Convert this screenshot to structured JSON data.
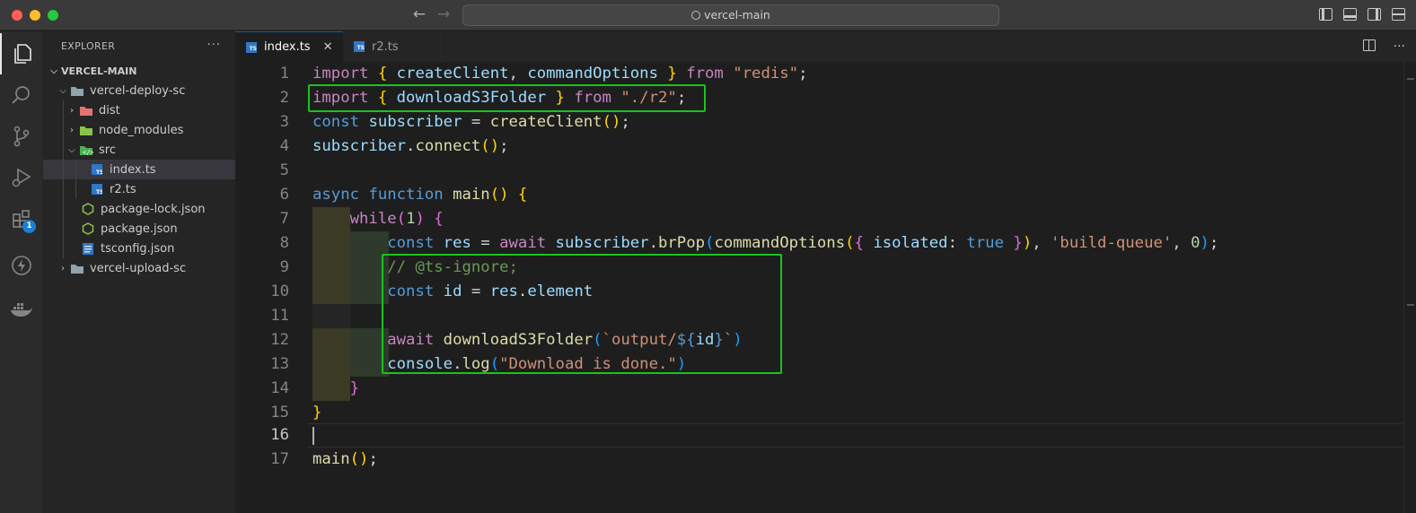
{
  "window": {
    "search_text": "vercel-main"
  },
  "activity_bar": {
    "extensions_badge": "1"
  },
  "explorer": {
    "title": "EXPLORER",
    "more": "···",
    "root": "VERCEL-MAIN",
    "items": [
      {
        "label": "vercel-deploy-sc",
        "type": "folder"
      },
      {
        "label": "dist",
        "type": "folder"
      },
      {
        "label": "node_modules",
        "type": "folder"
      },
      {
        "label": "src",
        "type": "folder"
      },
      {
        "label": "index.ts",
        "type": "ts"
      },
      {
        "label": "r2.ts",
        "type": "ts"
      },
      {
        "label": "package-lock.json",
        "type": "json"
      },
      {
        "label": "package.json",
        "type": "json"
      },
      {
        "label": "tsconfig.json",
        "type": "tsconfig"
      },
      {
        "label": "vercel-upload-sc",
        "type": "folder"
      }
    ]
  },
  "tabs": [
    {
      "label": "index.ts",
      "close": "✕"
    },
    {
      "label": "r2.ts"
    }
  ],
  "code": {
    "line_numbers": [
      "1",
      "2",
      "3",
      "4",
      "5",
      "6",
      "7",
      "8",
      "9",
      "10",
      "11",
      "12",
      "13",
      "14",
      "15",
      "16",
      "17"
    ],
    "l1": {
      "import": "import",
      "ob": "{",
      "a": "createClient",
      "comma": ",",
      "b": "commandOptions",
      "cb": "}",
      "from": "from",
      "str": "\"redis\"",
      "semi": ";"
    },
    "l2": {
      "import": "import",
      "ob": "{",
      "a": "downloadS3Folder",
      "cb": "}",
      "from": "from",
      "str": "\"./r2\"",
      "semi": ";"
    },
    "l3": {
      "const": "const",
      "v": "subscriber",
      "eq": "=",
      "fn": "createClient",
      "p": "()",
      "semi": ";"
    },
    "l4": {
      "v": "subscriber",
      "dot": ".",
      "fn": "connect",
      "p": "()",
      "semi": ";"
    },
    "l6": {
      "async": "async",
      "function": "function",
      "fn": "main",
      "p": "()",
      "ob": "{"
    },
    "l7": {
      "while": "while",
      "op": "(",
      "num": "1",
      "cp": ")",
      "ob": "{"
    },
    "l8": {
      "const": "const",
      "v": "res",
      "eq": "=",
      "await": "await",
      "obj": "subscriber",
      "dot": ".",
      "fn": "brPop",
      "op": "(",
      "fn2": "commandOptions",
      "op2": "(",
      "ob": "{",
      "key": "isolated",
      "colon": ":",
      "val": "true",
      "cb": "}",
      "cp2": ")",
      "comma": ",",
      "str": "'build-queue'",
      "comma2": ",",
      "num": "0",
      "cp": ")",
      "semi": ";"
    },
    "l9": {
      "comment": "// @ts-ignore;"
    },
    "l10": {
      "const": "const",
      "v": "id",
      "eq": "=",
      "obj": "res",
      "dot": ".",
      "prop": "element"
    },
    "l12": {
      "await": "await",
      "fn": "downloadS3Folder",
      "op": "(",
      "tpl1": "`output/",
      "dl": "${",
      "v": "id",
      "dr": "}",
      "tpl2": "`",
      "cp": ")"
    },
    "l13": {
      "obj": "console",
      "dot": ".",
      "fn": "log",
      "op": "(",
      "str": "\"Download is done.\"",
      "cp": ")"
    },
    "l14": {
      "cb": "}"
    },
    "l15": {
      "cb": "}"
    },
    "l17": {
      "fn": "main",
      "p": "()",
      "semi": ";"
    }
  },
  "colors": {
    "highlight_box": "#19c41c",
    "accent": "#0e639c",
    "badge": "#1c7ed6"
  }
}
